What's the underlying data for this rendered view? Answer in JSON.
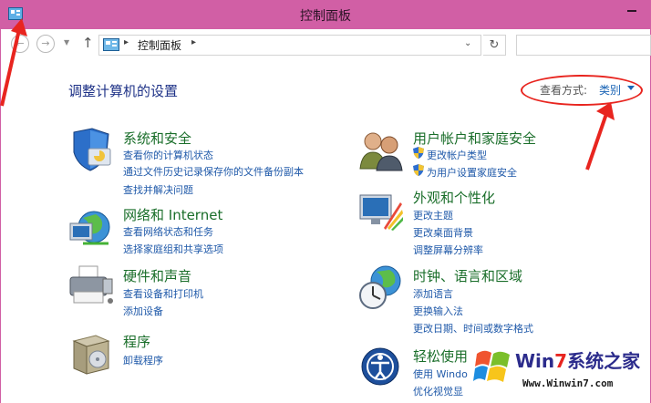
{
  "window": {
    "title": "控制面板"
  },
  "address": {
    "crumb": "控制面板",
    "separator": "▸"
  },
  "header": {
    "title": "调整计算机的设置",
    "view_by_label": "查看方式:",
    "view_by_value": "类别"
  },
  "categories": [
    {
      "title": "系统和安全",
      "links": [
        "查看你的计算机状态",
        "通过文件历史记录保存你的文件备份副本",
        "查找并解决问题"
      ]
    },
    {
      "title": "网络和 Internet",
      "links": [
        "查看网络状态和任务",
        "选择家庭组和共享选项"
      ]
    },
    {
      "title": "硬件和声音",
      "links": [
        "查看设备和打印机",
        "添加设备"
      ]
    },
    {
      "title": "程序",
      "links": [
        "卸载程序"
      ]
    },
    {
      "title": "用户帐户和家庭安全",
      "links": [
        "更改帐户类型",
        "为用户设置家庭安全"
      ]
    },
    {
      "title": "外观和个性化",
      "links": [
        "更改主题",
        "更改桌面背景",
        "调整屏幕分辨率"
      ]
    },
    {
      "title": "时钟、语言和区域",
      "links": [
        "添加语言",
        "更换输入法",
        "更改日期、时间或数字格式"
      ]
    },
    {
      "title": "轻松使用",
      "links": [
        "使用 Windo",
        "优化视觉显"
      ]
    }
  ],
  "watermark": {
    "brand_a": "Win",
    "brand_b": "7",
    "brand_c": "系统之家",
    "site": "Www.Winwin7.com"
  },
  "colors": {
    "title_bar": "#d15fa5",
    "heading": "#1a6e2a",
    "link": "#1f59a9",
    "page_title": "#1e3287",
    "annotation": "#e8251f"
  }
}
